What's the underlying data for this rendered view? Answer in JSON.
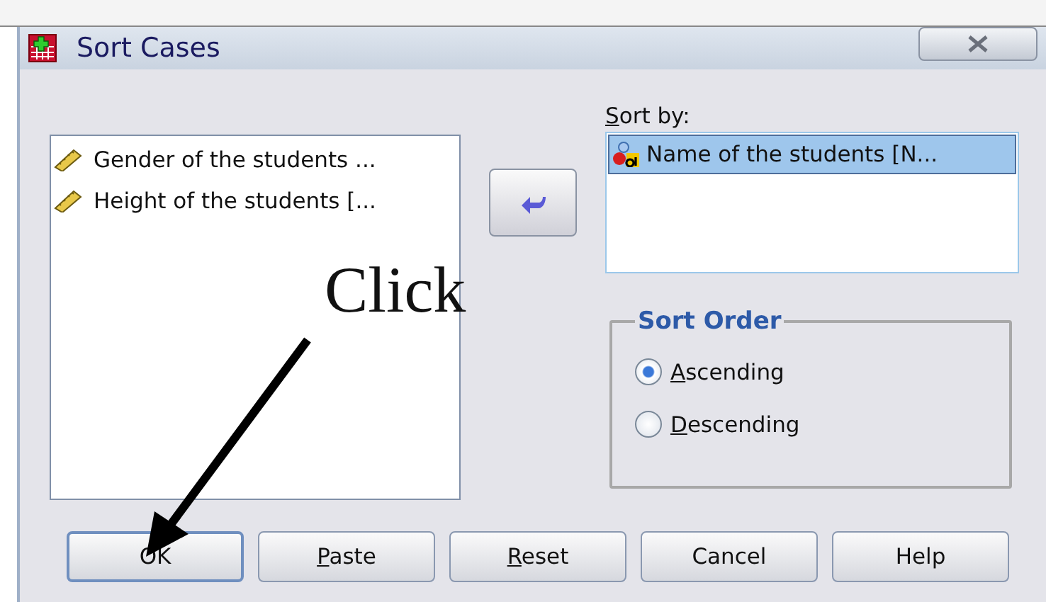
{
  "window": {
    "title": "Sort Cases"
  },
  "variables": [
    {
      "label": "Gender of the students ...",
      "kind": "scale"
    },
    {
      "label": "Height of the students [...",
      "kind": "scale"
    }
  ],
  "sort_by": {
    "label": "Sort by:",
    "underline_first": true,
    "items": [
      {
        "label": "Name of the students [N...",
        "kind": "nominal",
        "selected": true
      }
    ]
  },
  "sort_order": {
    "title": "Sort Order",
    "options": [
      {
        "label": "Ascending",
        "selected": true,
        "underline_first": true
      },
      {
        "label": "Descending",
        "selected": false,
        "underline_first": true
      }
    ]
  },
  "buttons": [
    {
      "label": "OK",
      "underline_first": false,
      "focused": true
    },
    {
      "label": "Paste",
      "underline_first": true,
      "focused": false
    },
    {
      "label": "Reset",
      "underline_first": true,
      "focused": false
    },
    {
      "label": "Cancel",
      "underline_first": false,
      "focused": false
    },
    {
      "label": "Help",
      "underline_first": false,
      "focused": false
    }
  ],
  "annotation": {
    "text": "Click"
  }
}
